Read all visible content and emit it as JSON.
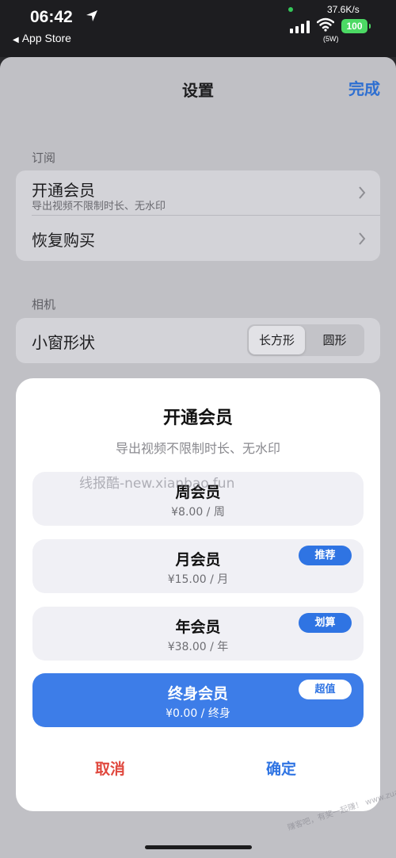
{
  "status_bar": {
    "time": "06:42",
    "back_app": "App Store",
    "network_speed": "37.6K/s",
    "wifi_label": "(5W)",
    "battery": "100"
  },
  "nav": {
    "title": "设置",
    "done": "完成"
  },
  "sections": {
    "subscription": {
      "header": "订阅",
      "rows": [
        {
          "title": "开通会员",
          "subtitle": "导出视频不限制时长、无水印"
        },
        {
          "title": "恢复购买"
        }
      ]
    },
    "camera": {
      "header": "相机",
      "row_title": "小窗形状",
      "options": [
        "长方形",
        "圆形"
      ],
      "selected": "长方形"
    }
  },
  "modal": {
    "title": "开通会员",
    "subtitle": "导出视频不限制时长、无水印",
    "plans": [
      {
        "name": "周会员",
        "price": "¥8.00 / 周",
        "badge": ""
      },
      {
        "name": "月会员",
        "price": "¥15.00 / 月",
        "badge": "推荐"
      },
      {
        "name": "年会员",
        "price": "¥38.00 / 年",
        "badge": "划算"
      },
      {
        "name": "终身会员",
        "price": "¥0.00 / 终身",
        "badge": "超值",
        "selected": true
      }
    ],
    "cancel": "取消",
    "confirm": "确定"
  },
  "watermarks": {
    "center": "线报酷-new.xianbao.fun",
    "corner": "赚客吧，有奖一起赚！ www.zuanke8.com"
  },
  "colors": {
    "accent": "#2f74e3",
    "selected_plan": "#3d7de8",
    "cancel": "#e0483e",
    "battery": "#4cd964"
  }
}
